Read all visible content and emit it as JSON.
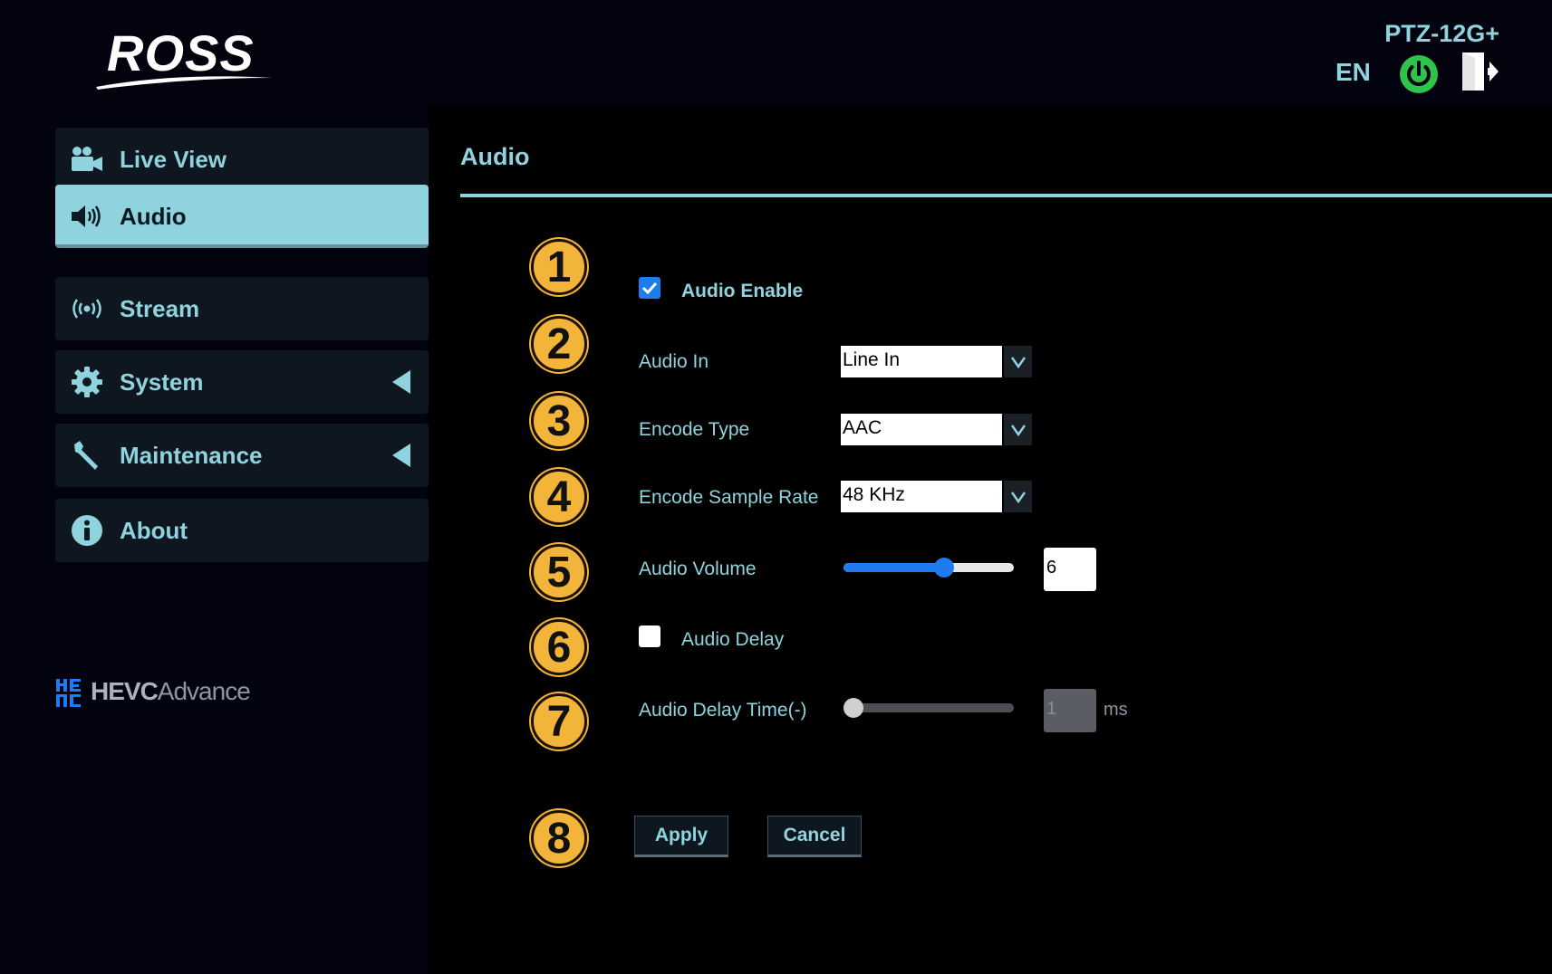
{
  "header": {
    "brand": "ROSS",
    "model": "PTZ-12G+",
    "language": "EN"
  },
  "sidebar": {
    "items": [
      {
        "label": "Live View",
        "icon": "camera-icon"
      },
      {
        "label": "Audio",
        "icon": "speaker-icon",
        "active": true
      },
      {
        "label": "Stream",
        "icon": "broadcast-icon"
      },
      {
        "label": "System",
        "icon": "gear-icon",
        "expandable": true
      },
      {
        "label": "Maintenance",
        "icon": "wrench-icon",
        "expandable": true
      },
      {
        "label": "About",
        "icon": "info-icon"
      }
    ],
    "footer_logo": {
      "part1": "HEVC",
      "part2": "Advance"
    }
  },
  "main": {
    "title": "Audio",
    "badges": [
      "1",
      "2",
      "3",
      "4",
      "5",
      "6",
      "7",
      "8"
    ],
    "audio_enable": {
      "label": "Audio Enable",
      "checked": true
    },
    "audio_in": {
      "label": "Audio In",
      "value": "Line In"
    },
    "encode_type": {
      "label": "Encode Type",
      "value": "AAC"
    },
    "encode_sample_rate": {
      "label": "Encode Sample Rate",
      "value": "48 KHz"
    },
    "audio_volume": {
      "label": "Audio Volume",
      "value": "6",
      "level_fraction": 0.6
    },
    "audio_delay": {
      "label": "Audio Delay",
      "checked": false
    },
    "audio_delay_time": {
      "label": "Audio Delay Time(-)",
      "value": "1",
      "unit": "ms",
      "level_fraction": 0.0
    },
    "apply_label": "Apply",
    "cancel_label": "Cancel"
  },
  "colors": {
    "accent": "#8fd3de",
    "background": "#02030f",
    "badge": "#f3b43a",
    "checkbox_on": "#1e7cf0",
    "power_green": "#2ec34a"
  }
}
